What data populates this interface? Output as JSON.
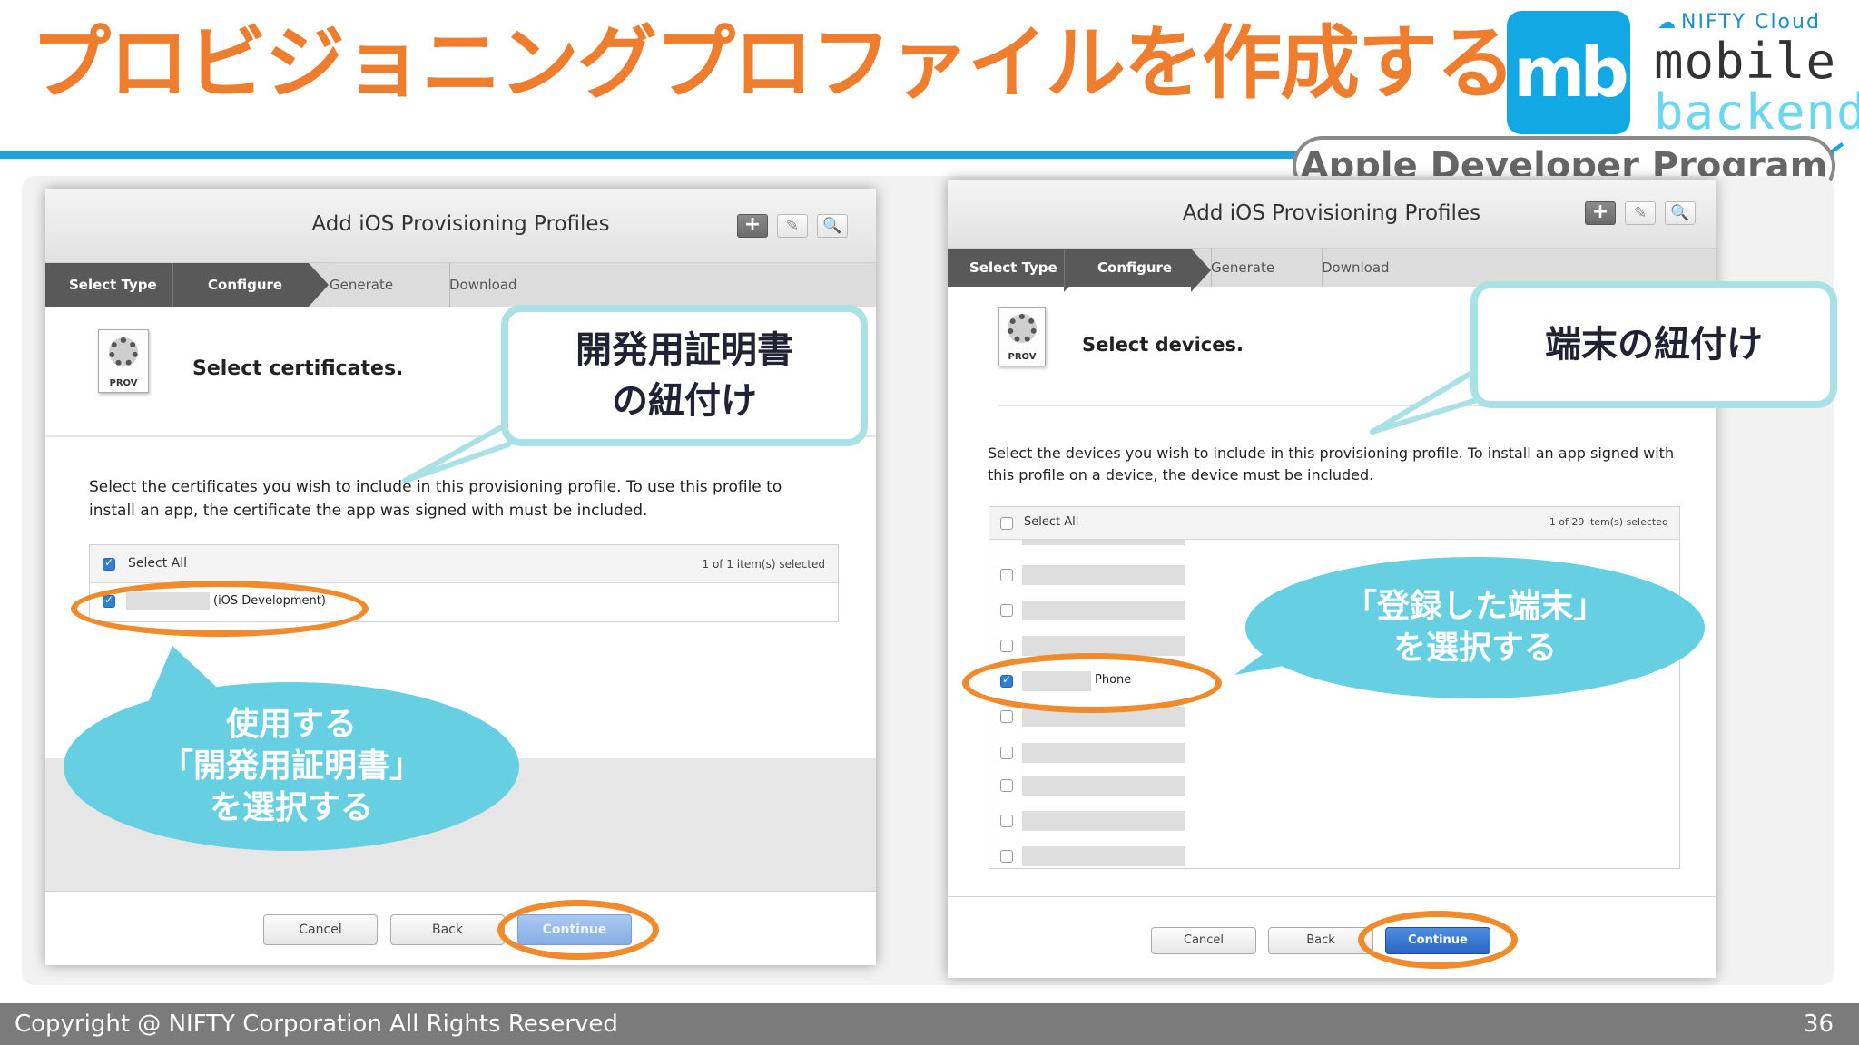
{
  "slide": {
    "title": "プロビジョニングプロファイルを作成する",
    "program_label": "Apple Developer Program",
    "page_number": "36",
    "copyright": "Copyright @ NIFTY Corporation All Rights Reserved"
  },
  "logo": {
    "mark": "mb",
    "company": "NIFTY Cloud",
    "line1": "mobile",
    "line2": "backend"
  },
  "left_dialog": {
    "title": "Add iOS Provisioning Profiles",
    "toolbar": {
      "add_icon": "+",
      "edit_icon": "✎",
      "search_icon": "🔍"
    },
    "steps": [
      "Select Type",
      "Configure",
      "Generate",
      "Download"
    ],
    "active_step": "Configure",
    "prov_label": "PROV",
    "heading": "Select certificates.",
    "description_line1": "Select the certificates you wish to include in this provisioning profile. To use this profile to",
    "description_line2": "install an app, the certificate the app was signed with must be included.",
    "select_all_label": "Select All",
    "count": "1   of 1 item(s) selected",
    "rows": [
      {
        "text": "(iOS Development)",
        "checked": true
      }
    ],
    "buttons": {
      "cancel": "Cancel",
      "back": "Back",
      "continue": "Continue"
    }
  },
  "right_dialog": {
    "title": "Add iOS Provisioning Profiles",
    "toolbar": {
      "add_icon": "+",
      "edit_icon": "✎",
      "search_icon": "🔍"
    },
    "steps": [
      "Select Type",
      "Configure",
      "Generate",
      "Download"
    ],
    "active_step": "Configure",
    "prov_label": "PROV",
    "heading": "Select devices.",
    "description_line1": "Select the devices you wish to include in this provisioning profile. To install an app signed with",
    "description_line2": "this profile on a device, the device must be included.",
    "select_all_label": "Select All",
    "count": "1   of 29 item(s) selected",
    "device_rows": [
      {
        "text": "",
        "checked": false
      },
      {
        "text": "",
        "checked": false
      },
      {
        "text": "",
        "checked": false
      },
      {
        "text": "Phone",
        "checked": true
      },
      {
        "text": "",
        "checked": false
      },
      {
        "text": "",
        "checked": false
      },
      {
        "text": "",
        "checked": false
      },
      {
        "text": "",
        "checked": false
      },
      {
        "text": "",
        "checked": false
      }
    ],
    "buttons": {
      "cancel": "Cancel",
      "back": "Back",
      "continue": "Continue"
    }
  },
  "annotations": {
    "cert_callout_line1": "開発用証明書",
    "cert_callout_line2": "の紐付け",
    "cert_bubble_line1": "使用する",
    "cert_bubble_line2": "「開発用証明書」",
    "cert_bubble_line3": "を選択する",
    "device_callout": "端末の紐付け",
    "device_bubble_line1": "「登録した端末」",
    "device_bubble_line2": "を選択する"
  },
  "colors": {
    "title_orange": "#ef7d2e",
    "accent_blue": "#1ba3dd",
    "callout_border": "#a9e1e6",
    "bubble": "#66cfe2",
    "ring": "#f08a2a",
    "primary_button": "#2a64c4"
  }
}
